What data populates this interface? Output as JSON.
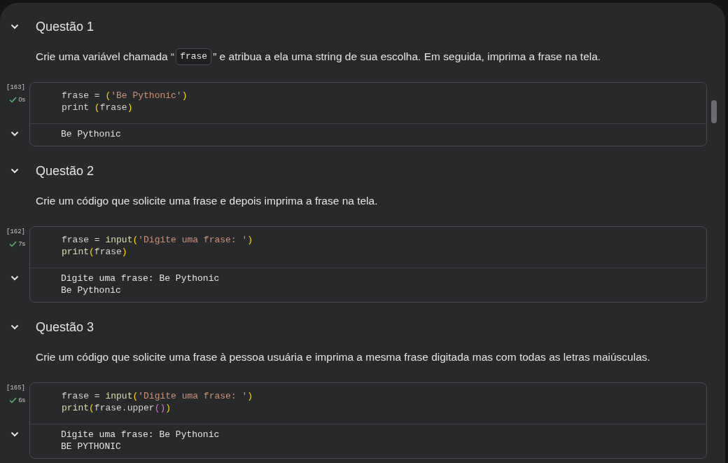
{
  "sections": [
    {
      "title": "Questão 1",
      "expanded": true,
      "description": [
        {
          "kind": "text",
          "text": "Crie uma variável chamada “"
        },
        {
          "kind": "code",
          "text": "frase"
        },
        {
          "kind": "text",
          "text": "” e atribua a ela uma string de sua escolha. Em seguida, imprima a frase na tela."
        }
      ],
      "cell": {
        "execution_count": "[163]",
        "succeeded": true,
        "duration": "0s",
        "output_expanded": true,
        "code": [
          [
            {
              "kind": "plain",
              "text": "frase = "
            },
            {
              "kind": "bracket",
              "text": "("
            },
            {
              "kind": "string",
              "text": "'Be Pythonic'"
            },
            {
              "kind": "bracket",
              "text": ")"
            }
          ],
          [
            {
              "kind": "plain",
              "text": "print "
            },
            {
              "kind": "bracket",
              "text": "("
            },
            {
              "kind": "plain",
              "text": "frase"
            },
            {
              "kind": "bracket",
              "text": ")"
            }
          ]
        ],
        "output": [
          "Be Pythonic"
        ]
      }
    },
    {
      "title": "Questão 2",
      "expanded": true,
      "description": [
        {
          "kind": "text",
          "text": "Crie um código que solicite uma frase e depois imprima a frase na tela."
        }
      ],
      "cell": {
        "execution_count": "[162]",
        "succeeded": true,
        "duration": "7s",
        "output_expanded": true,
        "code": [
          [
            {
              "kind": "plain",
              "text": "frase = "
            },
            {
              "kind": "func",
              "text": "input"
            },
            {
              "kind": "bracket",
              "text": "("
            },
            {
              "kind": "string",
              "text": "'Digite uma frase: '"
            },
            {
              "kind": "bracket",
              "text": ")"
            }
          ],
          [
            {
              "kind": "func",
              "text": "print"
            },
            {
              "kind": "bracket",
              "text": "("
            },
            {
              "kind": "plain",
              "text": "frase"
            },
            {
              "kind": "bracket",
              "text": ")"
            }
          ]
        ],
        "output": [
          "Digite uma frase: Be Pythonic",
          "Be Pythonic"
        ]
      }
    },
    {
      "title": "Questão 3",
      "expanded": true,
      "description": [
        {
          "kind": "text",
          "text": "Crie um código que solicite uma frase à pessoa usuária e imprima a mesma frase digitada mas com todas as letras maiúsculas."
        }
      ],
      "cell": {
        "execution_count": "[165]",
        "succeeded": true,
        "duration": "6s",
        "output_expanded": true,
        "code": [
          [
            {
              "kind": "plain",
              "text": "frase = "
            },
            {
              "kind": "func",
              "text": "input"
            },
            {
              "kind": "bracket",
              "text": "("
            },
            {
              "kind": "string",
              "text": "'Digite uma frase: '"
            },
            {
              "kind": "bracket",
              "text": ")"
            }
          ],
          [
            {
              "kind": "func",
              "text": "print"
            },
            {
              "kind": "bracket",
              "text": "("
            },
            {
              "kind": "plain",
              "text": "frase.upper"
            },
            {
              "kind": "bracket2",
              "text": "()"
            },
            {
              "kind": "bracket",
              "text": ")"
            }
          ]
        ],
        "output": [
          "Digite uma frase: Be Pythonic",
          "BE PYTHONIC"
        ]
      }
    }
  ]
}
